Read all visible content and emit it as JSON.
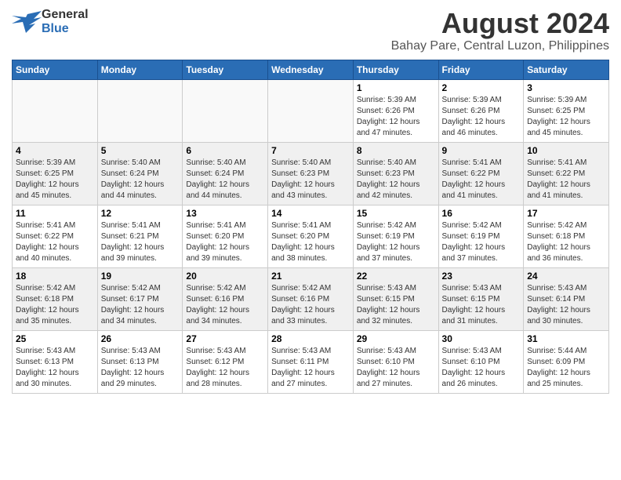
{
  "header": {
    "logo": {
      "text_general": "General",
      "text_blue": "Blue"
    },
    "title": "August 2024",
    "subtitle": "Bahay Pare, Central Luzon, Philippines"
  },
  "calendar": {
    "weekdays": [
      "Sunday",
      "Monday",
      "Tuesday",
      "Wednesday",
      "Thursday",
      "Friday",
      "Saturday"
    ],
    "weeks": [
      [
        {
          "day": "",
          "info": ""
        },
        {
          "day": "",
          "info": ""
        },
        {
          "day": "",
          "info": ""
        },
        {
          "day": "",
          "info": ""
        },
        {
          "day": "1",
          "info": "Sunrise: 5:39 AM\nSunset: 6:26 PM\nDaylight: 12 hours\nand 47 minutes."
        },
        {
          "day": "2",
          "info": "Sunrise: 5:39 AM\nSunset: 6:26 PM\nDaylight: 12 hours\nand 46 minutes."
        },
        {
          "day": "3",
          "info": "Sunrise: 5:39 AM\nSunset: 6:25 PM\nDaylight: 12 hours\nand 45 minutes."
        }
      ],
      [
        {
          "day": "4",
          "info": "Sunrise: 5:39 AM\nSunset: 6:25 PM\nDaylight: 12 hours\nand 45 minutes."
        },
        {
          "day": "5",
          "info": "Sunrise: 5:40 AM\nSunset: 6:24 PM\nDaylight: 12 hours\nand 44 minutes."
        },
        {
          "day": "6",
          "info": "Sunrise: 5:40 AM\nSunset: 6:24 PM\nDaylight: 12 hours\nand 44 minutes."
        },
        {
          "day": "7",
          "info": "Sunrise: 5:40 AM\nSunset: 6:23 PM\nDaylight: 12 hours\nand 43 minutes."
        },
        {
          "day": "8",
          "info": "Sunrise: 5:40 AM\nSunset: 6:23 PM\nDaylight: 12 hours\nand 42 minutes."
        },
        {
          "day": "9",
          "info": "Sunrise: 5:41 AM\nSunset: 6:22 PM\nDaylight: 12 hours\nand 41 minutes."
        },
        {
          "day": "10",
          "info": "Sunrise: 5:41 AM\nSunset: 6:22 PM\nDaylight: 12 hours\nand 41 minutes."
        }
      ],
      [
        {
          "day": "11",
          "info": "Sunrise: 5:41 AM\nSunset: 6:22 PM\nDaylight: 12 hours\nand 40 minutes."
        },
        {
          "day": "12",
          "info": "Sunrise: 5:41 AM\nSunset: 6:21 PM\nDaylight: 12 hours\nand 39 minutes."
        },
        {
          "day": "13",
          "info": "Sunrise: 5:41 AM\nSunset: 6:20 PM\nDaylight: 12 hours\nand 39 minutes."
        },
        {
          "day": "14",
          "info": "Sunrise: 5:41 AM\nSunset: 6:20 PM\nDaylight: 12 hours\nand 38 minutes."
        },
        {
          "day": "15",
          "info": "Sunrise: 5:42 AM\nSunset: 6:19 PM\nDaylight: 12 hours\nand 37 minutes."
        },
        {
          "day": "16",
          "info": "Sunrise: 5:42 AM\nSunset: 6:19 PM\nDaylight: 12 hours\nand 37 minutes."
        },
        {
          "day": "17",
          "info": "Sunrise: 5:42 AM\nSunset: 6:18 PM\nDaylight: 12 hours\nand 36 minutes."
        }
      ],
      [
        {
          "day": "18",
          "info": "Sunrise: 5:42 AM\nSunset: 6:18 PM\nDaylight: 12 hours\nand 35 minutes."
        },
        {
          "day": "19",
          "info": "Sunrise: 5:42 AM\nSunset: 6:17 PM\nDaylight: 12 hours\nand 34 minutes."
        },
        {
          "day": "20",
          "info": "Sunrise: 5:42 AM\nSunset: 6:16 PM\nDaylight: 12 hours\nand 34 minutes."
        },
        {
          "day": "21",
          "info": "Sunrise: 5:42 AM\nSunset: 6:16 PM\nDaylight: 12 hours\nand 33 minutes."
        },
        {
          "day": "22",
          "info": "Sunrise: 5:43 AM\nSunset: 6:15 PM\nDaylight: 12 hours\nand 32 minutes."
        },
        {
          "day": "23",
          "info": "Sunrise: 5:43 AM\nSunset: 6:15 PM\nDaylight: 12 hours\nand 31 minutes."
        },
        {
          "day": "24",
          "info": "Sunrise: 5:43 AM\nSunset: 6:14 PM\nDaylight: 12 hours\nand 30 minutes."
        }
      ],
      [
        {
          "day": "25",
          "info": "Sunrise: 5:43 AM\nSunset: 6:13 PM\nDaylight: 12 hours\nand 30 minutes."
        },
        {
          "day": "26",
          "info": "Sunrise: 5:43 AM\nSunset: 6:13 PM\nDaylight: 12 hours\nand 29 minutes."
        },
        {
          "day": "27",
          "info": "Sunrise: 5:43 AM\nSunset: 6:12 PM\nDaylight: 12 hours\nand 28 minutes."
        },
        {
          "day": "28",
          "info": "Sunrise: 5:43 AM\nSunset: 6:11 PM\nDaylight: 12 hours\nand 27 minutes."
        },
        {
          "day": "29",
          "info": "Sunrise: 5:43 AM\nSunset: 6:10 PM\nDaylight: 12 hours\nand 27 minutes."
        },
        {
          "day": "30",
          "info": "Sunrise: 5:43 AM\nSunset: 6:10 PM\nDaylight: 12 hours\nand 26 minutes."
        },
        {
          "day": "31",
          "info": "Sunrise: 5:44 AM\nSunset: 6:09 PM\nDaylight: 12 hours\nand 25 minutes."
        }
      ]
    ]
  }
}
